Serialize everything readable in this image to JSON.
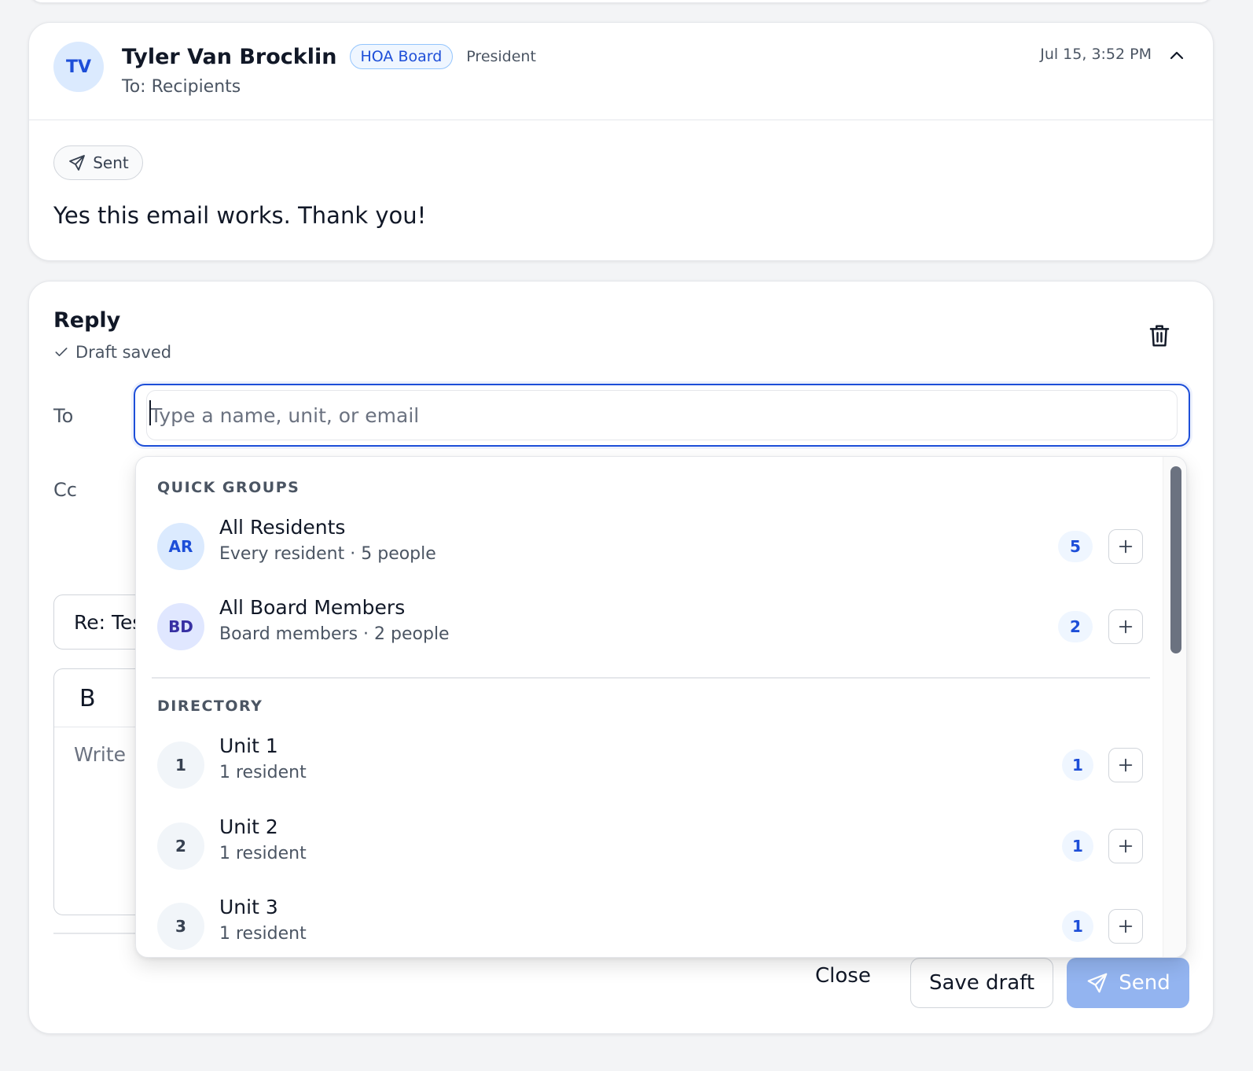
{
  "message": {
    "avatar_initials": "TV",
    "sender_name": "Tyler Van Brocklin",
    "badge": "HOA Board",
    "role": "President",
    "to_line": "To: Recipients",
    "timestamp": "Jul 15, 3:52 PM",
    "status": "Sent",
    "body": "Yes this email works. Thank you!"
  },
  "reply": {
    "title": "Reply",
    "draft_status": "Draft saved",
    "to_label": "To",
    "cc_label": "Cc",
    "to_placeholder": "Type a name, unit, or email",
    "subject_value": "Re: Tes",
    "bold_label": "B",
    "editor_placeholder": "Write",
    "close_label": "Close",
    "save_draft_label": "Save draft",
    "send_label": "Send"
  },
  "dropdown": {
    "quick_groups_heading": "QUICK GROUPS",
    "quick_groups": [
      {
        "initials": "AR",
        "title": "All Residents",
        "subtitle": "Every resident · 5 people",
        "count": "5"
      },
      {
        "initials": "BD",
        "title": "All Board Members",
        "subtitle": "Board members · 2 people",
        "count": "2"
      }
    ],
    "directory_heading": "DIRECTORY",
    "directory": [
      {
        "initials": "1",
        "title": "Unit 1",
        "subtitle": "1 resident",
        "count": "1"
      },
      {
        "initials": "2",
        "title": "Unit 2",
        "subtitle": "1 resident",
        "count": "1"
      },
      {
        "initials": "3",
        "title": "Unit 3",
        "subtitle": "1 resident",
        "count": "1"
      }
    ]
  },
  "colors": {
    "accent": "#1d4ed8",
    "send_disabled": "#93b4f0",
    "avatar_bg": "#dbeafe"
  }
}
